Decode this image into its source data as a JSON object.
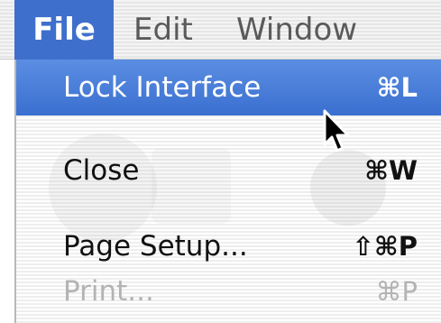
{
  "menubar": {
    "file_label": "File",
    "edit_label": "Edit",
    "window_label": "Window"
  },
  "file_menu": {
    "items": [
      {
        "label": "Lock Interface",
        "shortcut": "⌘L",
        "state": "highlighted"
      },
      {
        "label": "Close",
        "shortcut": "⌘W",
        "state": "enabled"
      },
      {
        "label": "Page Setup...",
        "shortcut": "⇧⌘P",
        "state": "enabled"
      },
      {
        "label": "Print...",
        "shortcut": "⌘P",
        "state": "disabled"
      }
    ]
  },
  "colors": {
    "highlight": "#3f6fcc",
    "text": "#111111",
    "disabled_text": "#b3b3b3"
  },
  "icons": {
    "pointer": "mouse-pointer-icon"
  }
}
